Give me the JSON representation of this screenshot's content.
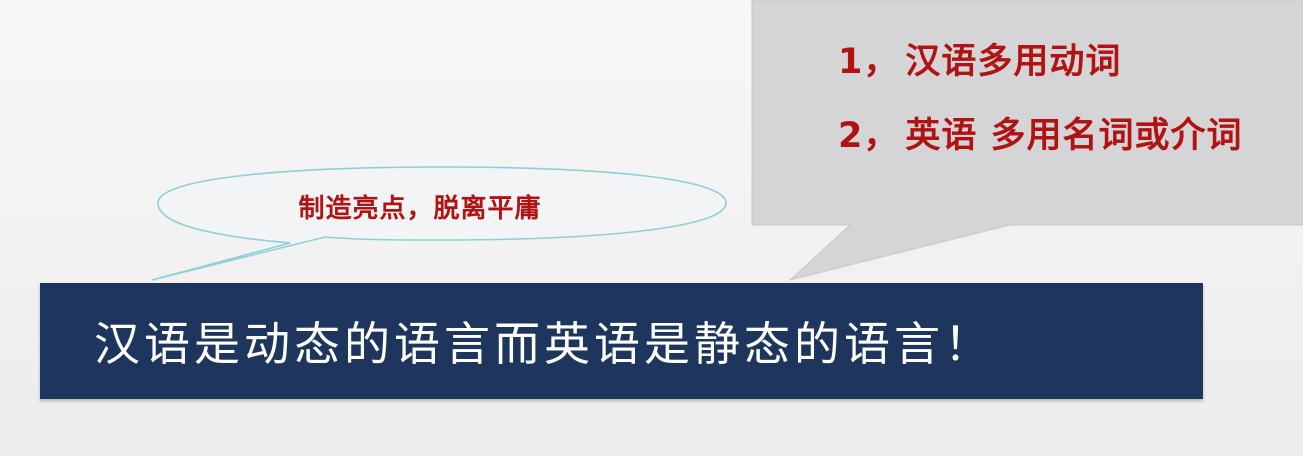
{
  "callout": {
    "items": [
      {
        "number": "1，",
        "text": "汉语多用动词"
      },
      {
        "number": "2，",
        "text": "英语 多用名词或介词"
      }
    ],
    "fill_color": "#d5d5d8",
    "text_color": "#b11212"
  },
  "oval": {
    "text": "制造亮点，脱离平庸",
    "text_color": "#b11212"
  },
  "banner": {
    "text": "汉语是动态的语言而英语是静态的语言！",
    "background_color": "#1e355e",
    "text_color": "#ffffff"
  }
}
